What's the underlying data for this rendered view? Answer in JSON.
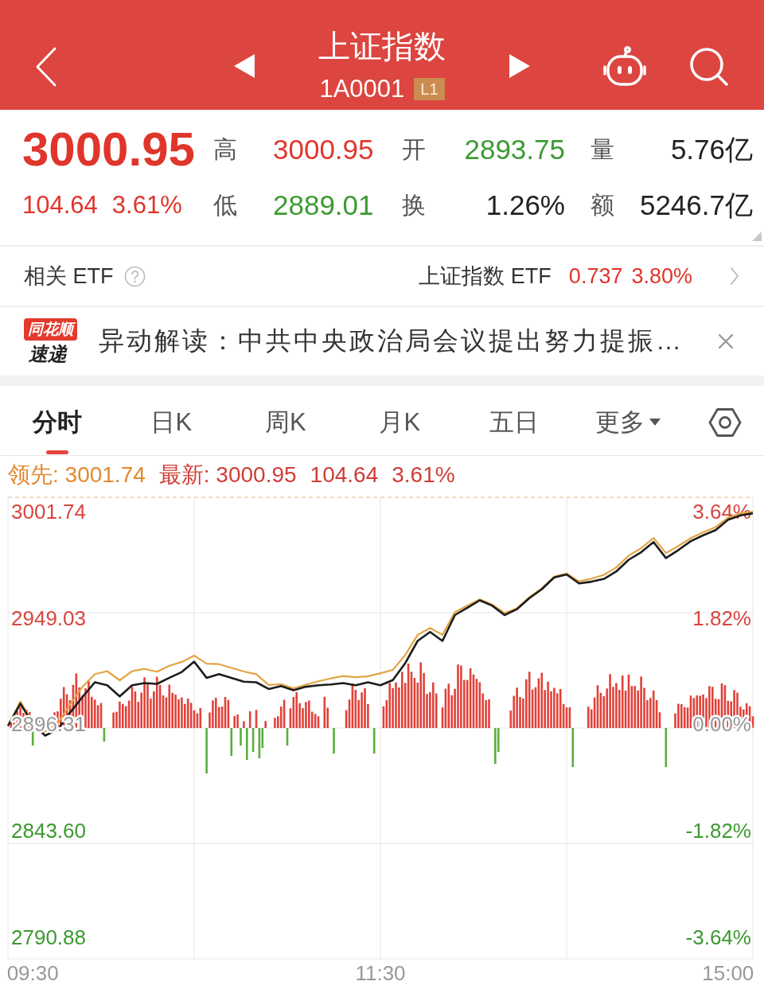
{
  "header": {
    "title": "上证指数",
    "code": "1A0001",
    "badge": "L1"
  },
  "quote": {
    "price": "3000.95",
    "change": "104.64",
    "change_pct": "3.61%",
    "rising": true,
    "stats": [
      {
        "label": "高",
        "value": "3000.95",
        "color": "#e0392f"
      },
      {
        "label": "开",
        "value": "2893.75",
        "color": "#3d9b33"
      },
      {
        "label": "量",
        "value": "5.76亿",
        "color": "#222222"
      },
      {
        "label": "低",
        "value": "2889.01",
        "color": "#3d9b33"
      },
      {
        "label": "换",
        "value": "1.26%",
        "color": "#222222"
      },
      {
        "label": "额",
        "value": "5246.7亿",
        "color": "#222222"
      }
    ]
  },
  "etf": {
    "label": "相关 ETF",
    "name": "上证指数 ETF",
    "price": "0.737",
    "change_pct": "3.80%",
    "rising": true
  },
  "news": {
    "brand_top": "同花顺",
    "brand_bottom": "速递",
    "text": "异动解读：中共中央政治局会议提出努力提振…"
  },
  "tabs": [
    {
      "label": "分时",
      "selected": true
    },
    {
      "label": "日K",
      "selected": false
    },
    {
      "label": "周K",
      "selected": false
    },
    {
      "label": "月K",
      "selected": false
    },
    {
      "label": "五日",
      "selected": false
    },
    {
      "label": "更多",
      "selected": false,
      "kind": "menu"
    }
  ],
  "lead_line": [
    {
      "text": "领先: 3001.74",
      "color": "#e2892e"
    },
    {
      "text": "最新: 3000.95",
      "color": "#cf3d36"
    },
    {
      "text": "104.64",
      "color": "#cf3d36"
    },
    {
      "text": "3.61%",
      "color": "#cf3d36"
    }
  ],
  "chart": {
    "percent_labels": [
      "3.64%",
      "1.82%",
      "0.00%",
      "-1.82%",
      "-3.64%"
    ],
    "chart_data": {
      "type": "line",
      "categories": [
        null,
        null,
        "09:30",
        null,
        null,
        null,
        null,
        null,
        null,
        null,
        null,
        null,
        null,
        null,
        null,
        null,
        null,
        null,
        null,
        null,
        null,
        null,
        null,
        null,
        null,
        null,
        null,
        null,
        null,
        null,
        "11:30",
        null,
        null,
        null,
        null,
        null,
        null,
        null,
        null,
        null,
        null,
        null,
        null,
        null,
        null,
        null,
        null,
        null,
        null,
        null,
        null,
        null,
        null,
        null,
        null,
        null,
        null,
        null,
        "15:00",
        null,
        null
      ],
      "ylim": [
        2780.24,
        3008.83
      ],
      "yticks": [
        {
          "value": 3001.74,
          "label": "3001.74"
        },
        {
          "value": 2949.03,
          "label": "2949.03"
        },
        {
          "value": 2896.31,
          "label": "2896.31"
        },
        {
          "value": 2843.6,
          "label": "2843.60"
        },
        {
          "value": 2790.88,
          "label": "2790.88"
        }
      ],
      "series": [
        {
          "color": "#e4a443",
          "values": [
            2895.6,
            2907.7,
            2897.2,
            2892.8,
            2896.8,
            2906.2,
            2914.9,
            2921.2,
            2922.7,
            2918.2,
            2922.7,
            2923.8,
            2922.4,
            2925.4,
            2927.3,
            2930.4,
            2926.4,
            2926.2,
            2924.4,
            2922.5,
            2921.2,
            2915.9,
            2916.3,
            2914.2,
            2916.0,
            2917.7,
            2919.1,
            2920.3,
            2919.7,
            2920.2,
            2921.7,
            2923.3,
            2930.7,
            2940.7,
            2944.1,
            2940.7,
            2952.0,
            2955.1,
            2958.3,
            2955.7,
            2951.5,
            2953.9,
            2959.4,
            2963.8,
            2969.6,
            2971.1,
            2967.2,
            2968.5,
            2970.4,
            2974.1,
            2979.9,
            2983.6,
            2988.7,
            2981.2,
            2984.7,
            2988.6,
            2991.5,
            2994.1,
            2998.7,
            3000.9,
            3001.7
          ]
        },
        {
          "color": "#1c1c1c",
          "values": [
            2895.6,
            2906.6,
            2896.7,
            2890.8,
            2893.8,
            2902.2,
            2909.9,
            2917.2,
            2915.7,
            2910.2,
            2915.7,
            2916.8,
            2916.4,
            2919.4,
            2922.3,
            2927.4,
            2919.4,
            2921.2,
            2919.4,
            2917.5,
            2917.2,
            2913.9,
            2915.3,
            2913.2,
            2915.0,
            2915.7,
            2916.1,
            2916.8,
            2915.7,
            2917.2,
            2915.7,
            2918.3,
            2926.7,
            2937.7,
            2942.1,
            2937.7,
            2950.5,
            2954.1,
            2957.8,
            2955.2,
            2950.5,
            2953.4,
            2958.9,
            2963.3,
            2969.1,
            2970.6,
            2966.2,
            2967.0,
            2968.4,
            2972.1,
            2977.9,
            2981.6,
            2986.7,
            2978.7,
            2982.7,
            2987.1,
            2990.0,
            2992.6,
            2997.7,
            2999.9,
            3000.9
          ]
        }
      ]
    }
  }
}
